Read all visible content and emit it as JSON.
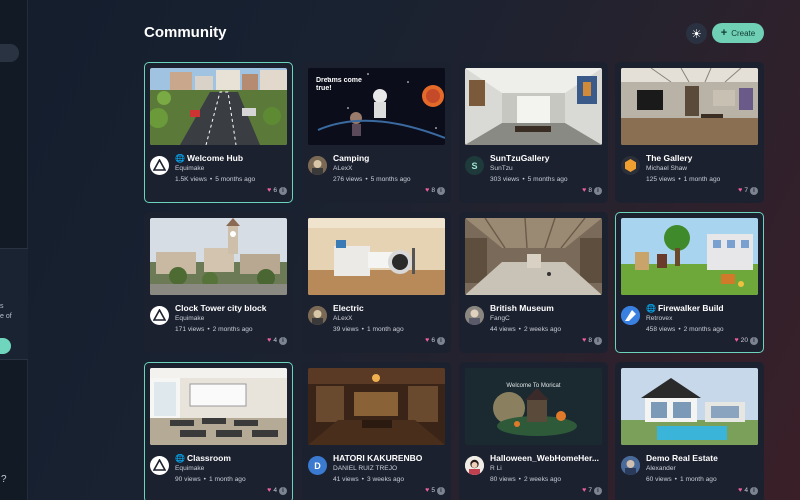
{
  "header": {
    "title": "Community",
    "theme_icon": "sun-icon",
    "create_label": "Create"
  },
  "sidebar": {
    "fragments": [
      "s",
      "e of"
    ],
    "help_icon": "help-icon"
  },
  "cards": [
    {
      "title": "Welcome Hub",
      "public": true,
      "author": "Equimake",
      "views": "1.5K views",
      "time": "5 months ago",
      "likes": "6",
      "highlighted": true
    },
    {
      "title": "Camping",
      "public": false,
      "author": "ALexX",
      "views": "276 views",
      "time": "5 months ago",
      "likes": "8",
      "highlighted": false
    },
    {
      "title": "SunTzuGallery",
      "public": false,
      "author": "SunTzu",
      "views": "303 views",
      "time": "5 months ago",
      "likes": "8",
      "highlighted": false
    },
    {
      "title": "The Gallery",
      "public": false,
      "author": "Michael Shaw",
      "views": "125 views",
      "time": "1 month ago",
      "likes": "7",
      "highlighted": false
    },
    {
      "title": "Clock Tower city block",
      "public": false,
      "author": "Equimake",
      "views": "171 views",
      "time": "2 months ago",
      "likes": "4",
      "highlighted": false
    },
    {
      "title": "Electric",
      "public": false,
      "author": "ALexX",
      "views": "39 views",
      "time": "1 month ago",
      "likes": "6",
      "highlighted": false
    },
    {
      "title": "British Museum",
      "public": false,
      "author": "FangC",
      "views": "44 views",
      "time": "2 weeks ago",
      "likes": "8",
      "highlighted": false
    },
    {
      "title": "Firewalker Build",
      "public": true,
      "author": "Retrovex",
      "views": "458 views",
      "time": "2 months ago",
      "likes": "20",
      "highlighted": true
    },
    {
      "title": "Classroom",
      "public": true,
      "author": "Equimake",
      "views": "90 views",
      "time": "1 month ago",
      "likes": "4",
      "highlighted": true
    },
    {
      "title": "HATORI KAKURENBO",
      "public": false,
      "author": "DANIEL RUIZ TREJO",
      "views": "41 views",
      "time": "3 weeks ago",
      "likes": "5",
      "highlighted": false
    },
    {
      "title": "Halloween_WebHomeHer...",
      "public": false,
      "author": "R Li",
      "views": "80 views",
      "time": "2 weeks ago",
      "likes": "7",
      "highlighted": false
    },
    {
      "title": "Demo Real Estate",
      "public": false,
      "author": "Alexander",
      "views": "60 views",
      "time": "1 month ago",
      "likes": "4",
      "highlighted": false
    }
  ],
  "thumb_text": {
    "camping": "Dreams come true!",
    "halloween": "Welcome To Moricat"
  },
  "avatar_letters": {
    "suntzu": "S",
    "hatori": "D"
  },
  "colors": {
    "accent": "#6fd0b6",
    "heart": "#ec5d9b",
    "card_bg": "#1c2130"
  }
}
